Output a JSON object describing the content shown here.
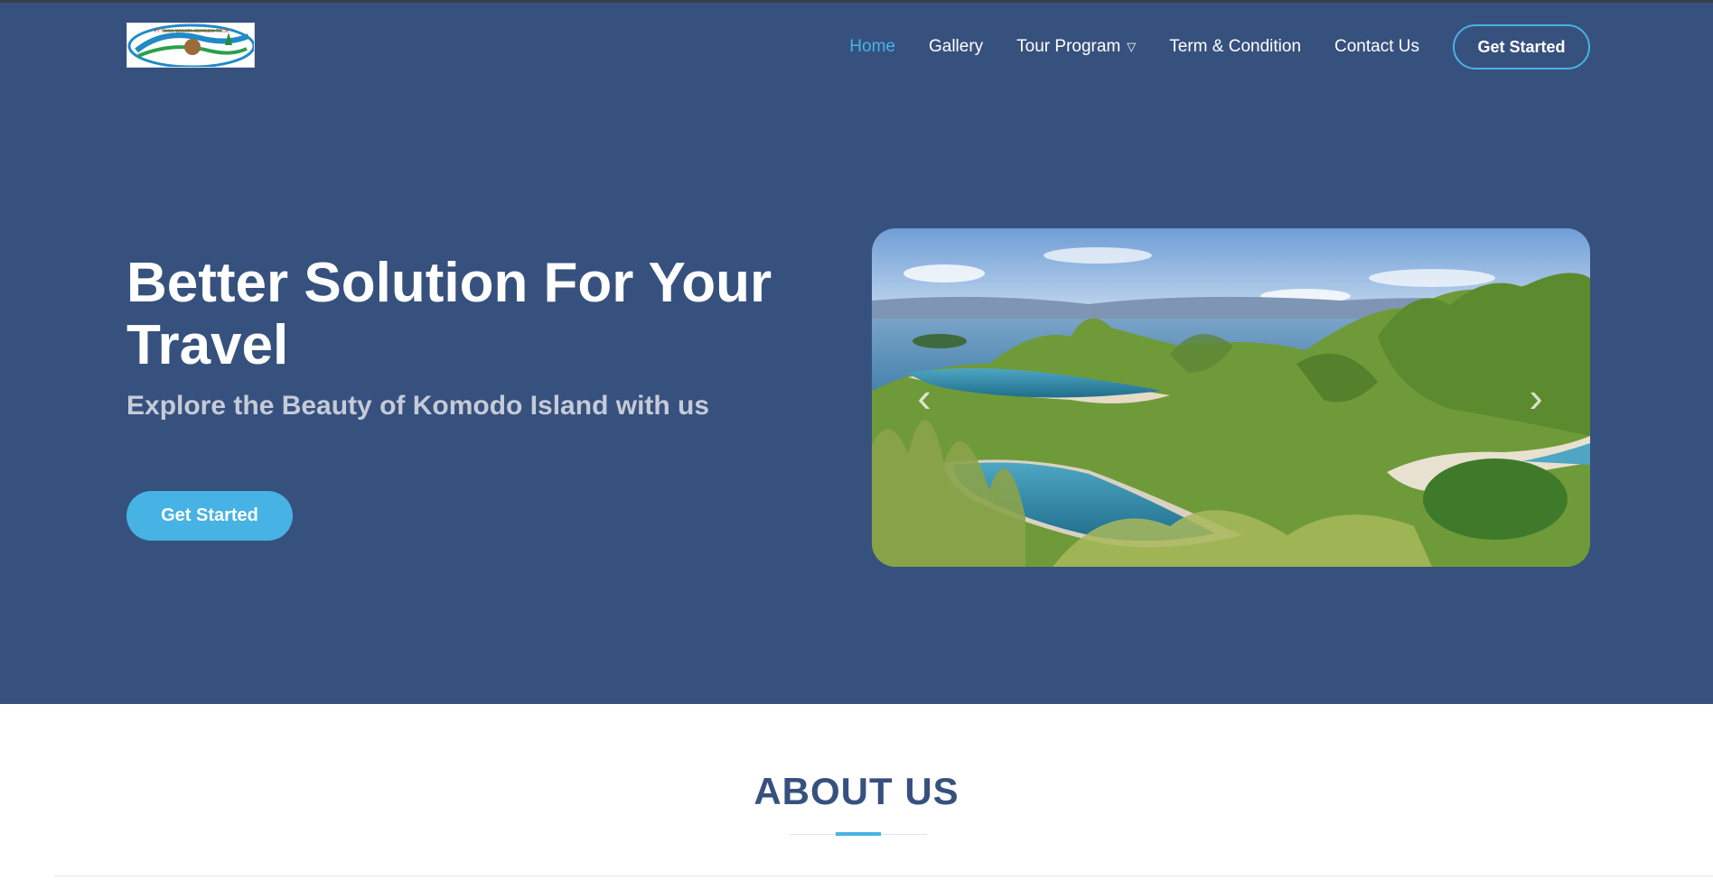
{
  "brand": {
    "logo_icon": "komodo-tour-logo",
    "logo_text": "PT NUSA WISATA KOMODO TOUR"
  },
  "nav": {
    "items": [
      {
        "label": "Home",
        "active": true
      },
      {
        "label": "Gallery"
      },
      {
        "label": "Tour Program",
        "icon": "chevron-down-icon"
      },
      {
        "label": "Term & Condition"
      },
      {
        "label": "Contact Us"
      }
    ],
    "cta_label": "Get Started"
  },
  "hero": {
    "title": "Better Solution For Your Travel",
    "subtitle": "Explore the Beauty of Komodo Island with us",
    "button_label": "Get Started"
  },
  "carousel": {
    "image": "komodo-island-landscape",
    "prev_icon": "chevron-left-icon",
    "next_icon": "chevron-right-icon"
  },
  "about": {
    "title": "ABOUT US"
  },
  "colors": {
    "hero_bg": "#37517e",
    "accent": "#47b2e4",
    "white": "#ffffff"
  }
}
